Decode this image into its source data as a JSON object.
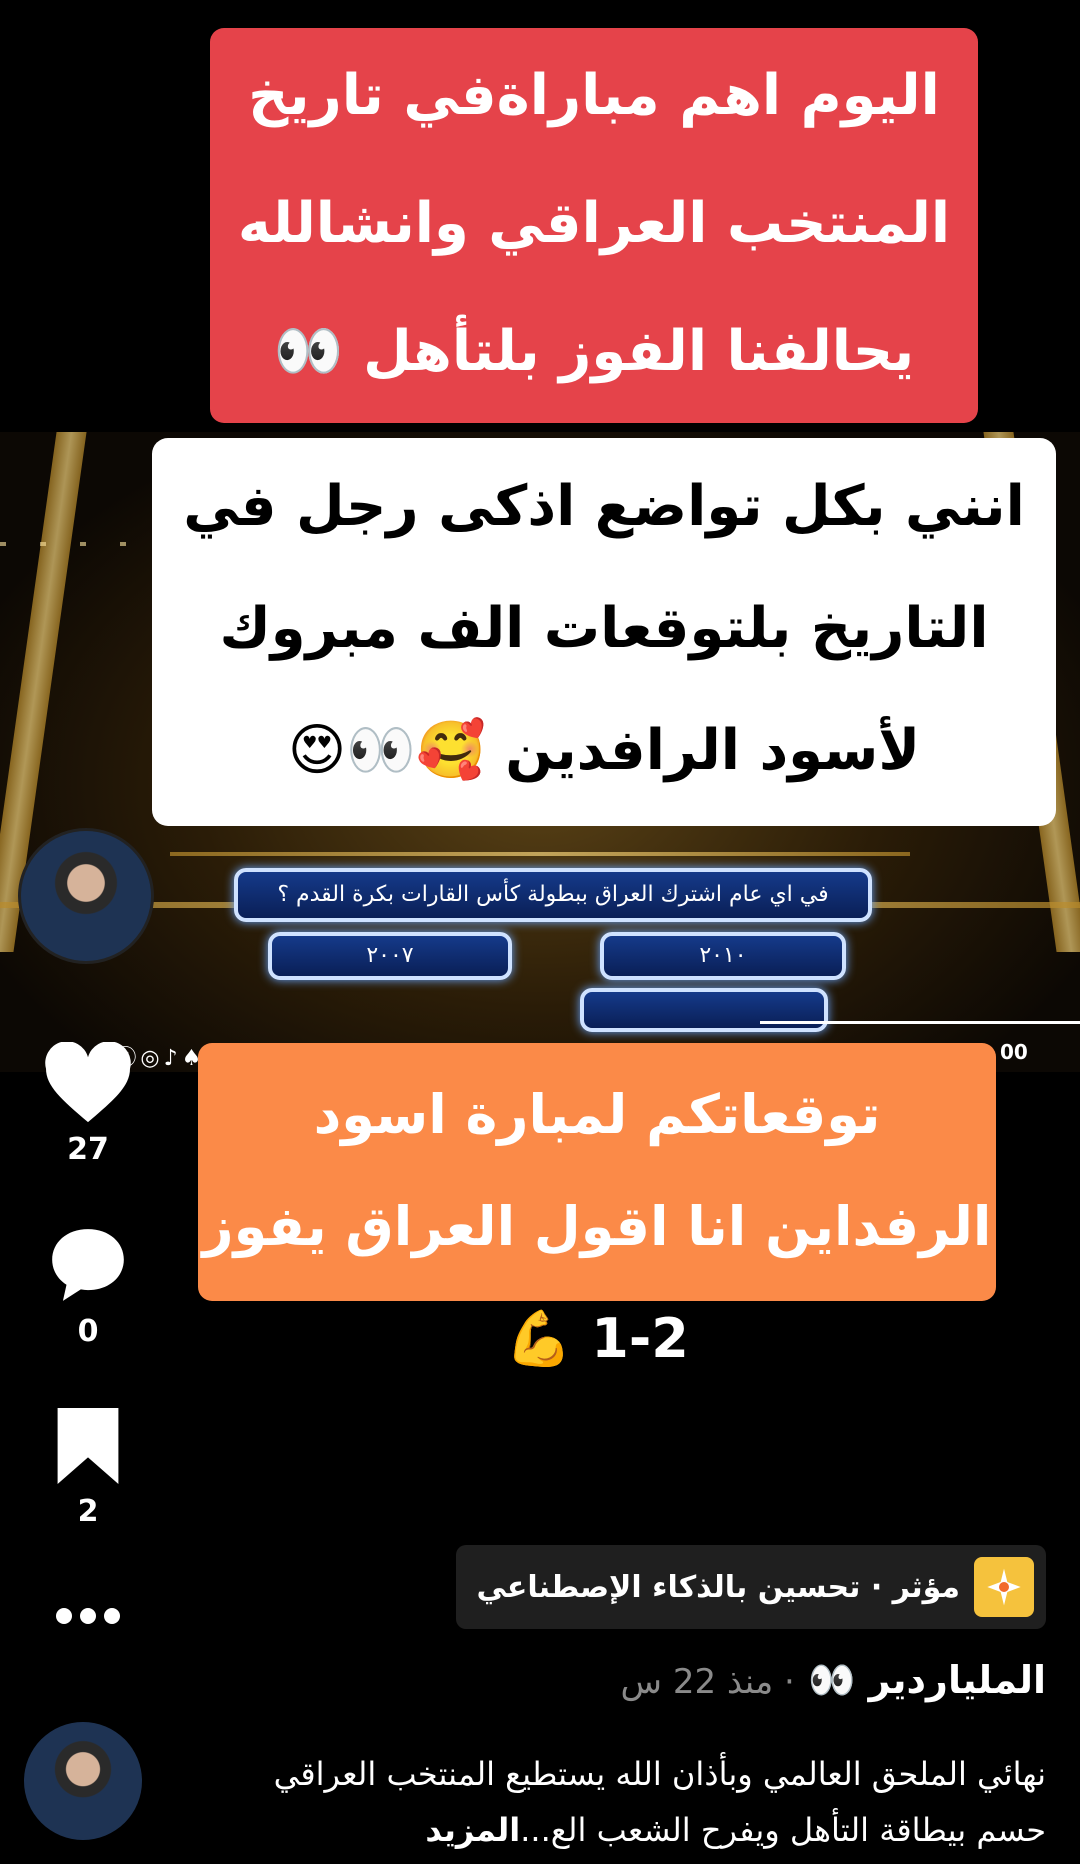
{
  "captions": {
    "top": "اليوم اهم مباراةفي تاريخ المنتخب العراقي وانشالله يحالفنا الفوز بلتأهل 👀",
    "middle": "انني بكل تواضع اذكى رجل في التاريخ بلتوقعات الف مبروك لأسود الرافدين 🥰👀😍",
    "bottom": "توقعاتكم لمبارة اسود الرفداين انا اقول العراق يفوز 2-1 💪"
  },
  "quiz": {
    "question": "في اي عام اشترك العراق ببطولة كأس القارات بكرة القدم ؟",
    "answer_a": "٢٠٠٧",
    "answer_b": "٢٠١٠",
    "answer_c": ""
  },
  "video": {
    "social_icons": "✕ⓧ◎♪♠➤",
    "counter": "00"
  },
  "actions": {
    "likes": "27",
    "comments": "0",
    "saves": "2"
  },
  "badge": {
    "text": "مؤثر · تحسين بالذكاء الإصطناعي",
    "icon": "sparkle-icon"
  },
  "post": {
    "author": "الملياردير 👀",
    "time": "منذ 22 س",
    "description": "نهائي الملحق العالمي وبأذان الله يستطيع المنتخب العراقي حسم بيطاقة التأهل ويفرح الشعب الع...",
    "more_label": "المزيد"
  },
  "colors": {
    "caption_red": "#e5434a",
    "caption_orange": "#fb8a48",
    "badge_yellow": "#f5c23d"
  }
}
